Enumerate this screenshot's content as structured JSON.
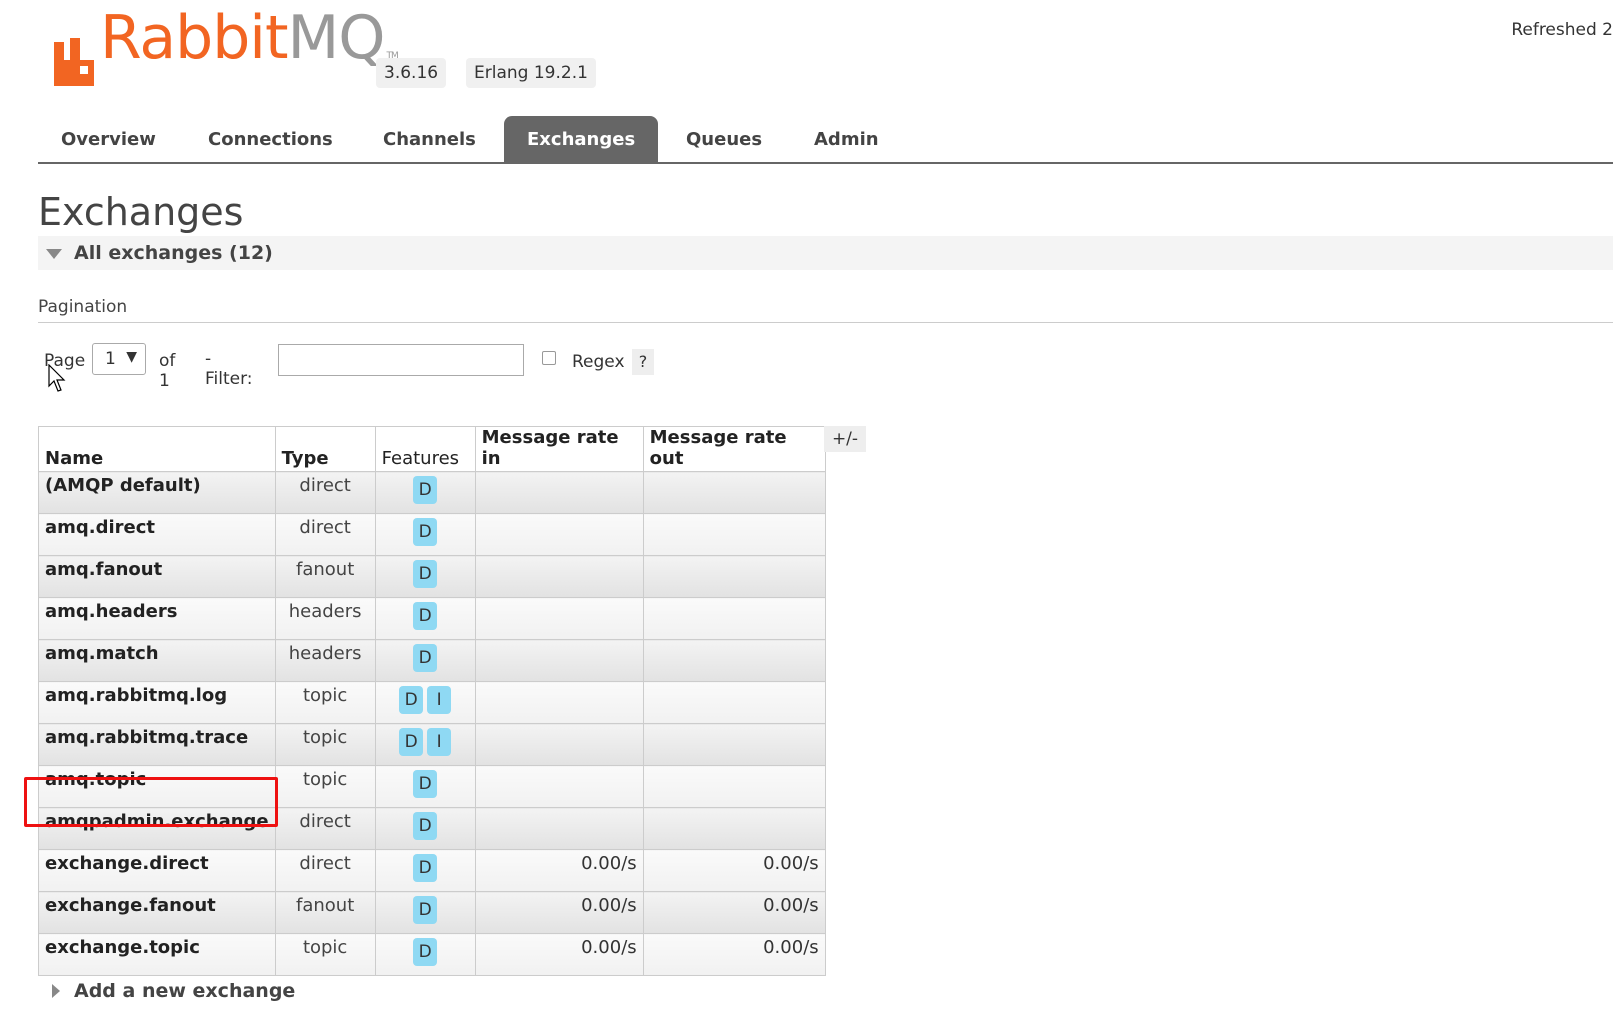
{
  "header": {
    "logo": {
      "primary": "Rabbit",
      "secondary": "MQ",
      "trademark": "TM"
    },
    "version": "3.6.16",
    "erlang": "Erlang 19.2.1",
    "refreshed": "Refreshed 2"
  },
  "tabs": [
    "Overview",
    "Connections",
    "Channels",
    "Exchanges",
    "Queues",
    "Admin"
  ],
  "active_tab": "Exchanges",
  "page_title": "Exchanges",
  "section": {
    "label": "All exchanges (12)"
  },
  "pagination": {
    "heading": "Pagination",
    "page_label": "Page",
    "page_value": "1",
    "of_label": "of 1",
    "filter_label": "- Filter:",
    "filter_value": "",
    "regex_label": "Regex",
    "regex_checked": false,
    "help": "?"
  },
  "table": {
    "headers": [
      "Name",
      "Type",
      "Features",
      "Message rate in",
      "Message rate out"
    ],
    "toggle_columns": "+/-",
    "rows": [
      {
        "name": "(AMQP default)",
        "type": "direct",
        "features": [
          "D"
        ],
        "rate_in": "",
        "rate_out": ""
      },
      {
        "name": "amq.direct",
        "type": "direct",
        "features": [
          "D"
        ],
        "rate_in": "",
        "rate_out": ""
      },
      {
        "name": "amq.fanout",
        "type": "fanout",
        "features": [
          "D"
        ],
        "rate_in": "",
        "rate_out": ""
      },
      {
        "name": "amq.headers",
        "type": "headers",
        "features": [
          "D"
        ],
        "rate_in": "",
        "rate_out": ""
      },
      {
        "name": "amq.match",
        "type": "headers",
        "features": [
          "D"
        ],
        "rate_in": "",
        "rate_out": ""
      },
      {
        "name": "amq.rabbitmq.log",
        "type": "topic",
        "features": [
          "D",
          "I"
        ],
        "rate_in": "",
        "rate_out": ""
      },
      {
        "name": "amq.rabbitmq.trace",
        "type": "topic",
        "features": [
          "D",
          "I"
        ],
        "rate_in": "",
        "rate_out": ""
      },
      {
        "name": "amq.topic",
        "type": "topic",
        "features": [
          "D"
        ],
        "rate_in": "",
        "rate_out": ""
      },
      {
        "name": "amqpadmin.exchange",
        "type": "direct",
        "features": [
          "D"
        ],
        "rate_in": "",
        "rate_out": ""
      },
      {
        "name": "exchange.direct",
        "type": "direct",
        "features": [
          "D"
        ],
        "rate_in": "0.00/s",
        "rate_out": "0.00/s"
      },
      {
        "name": "exchange.fanout",
        "type": "fanout",
        "features": [
          "D"
        ],
        "rate_in": "0.00/s",
        "rate_out": "0.00/s"
      },
      {
        "name": "exchange.topic",
        "type": "topic",
        "features": [
          "D"
        ],
        "rate_in": "0.00/s",
        "rate_out": "0.00/s"
      }
    ]
  },
  "add_exchange": {
    "label": "Add a new exchange"
  },
  "colors": {
    "brand": "#f26522",
    "tab_active": "#666666",
    "feature_badge": "#8fd9f3",
    "highlight": "#ee1111"
  },
  "icons": {
    "expand_open": "triangle-down-icon",
    "expand_closed": "triangle-right-icon",
    "dropdown": "caret-down-icon",
    "cursor": "mouse-pointer-icon"
  }
}
